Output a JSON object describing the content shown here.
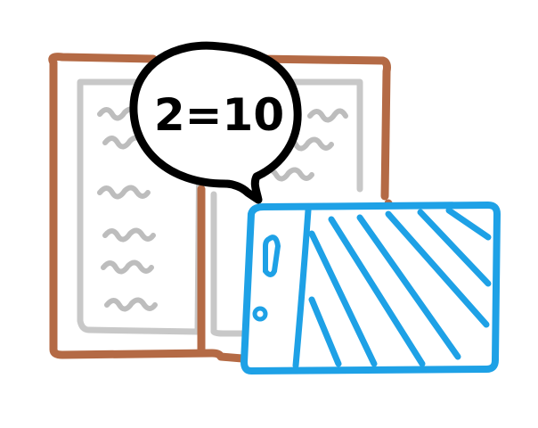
{
  "illustration": {
    "speech_bubble_text": "2=10",
    "colors": {
      "book_cover": "#b46a45",
      "book_pages": "#c8c8c8",
      "page_scribbles": "#bdbdbd",
      "bubble_outline": "#000000",
      "bubble_text": "#000000",
      "tablet": "#1ea1e6",
      "background": "#ffffff"
    },
    "icons": [
      "open-book-icon",
      "speech-bubble-icon",
      "tablet-icon"
    ]
  }
}
